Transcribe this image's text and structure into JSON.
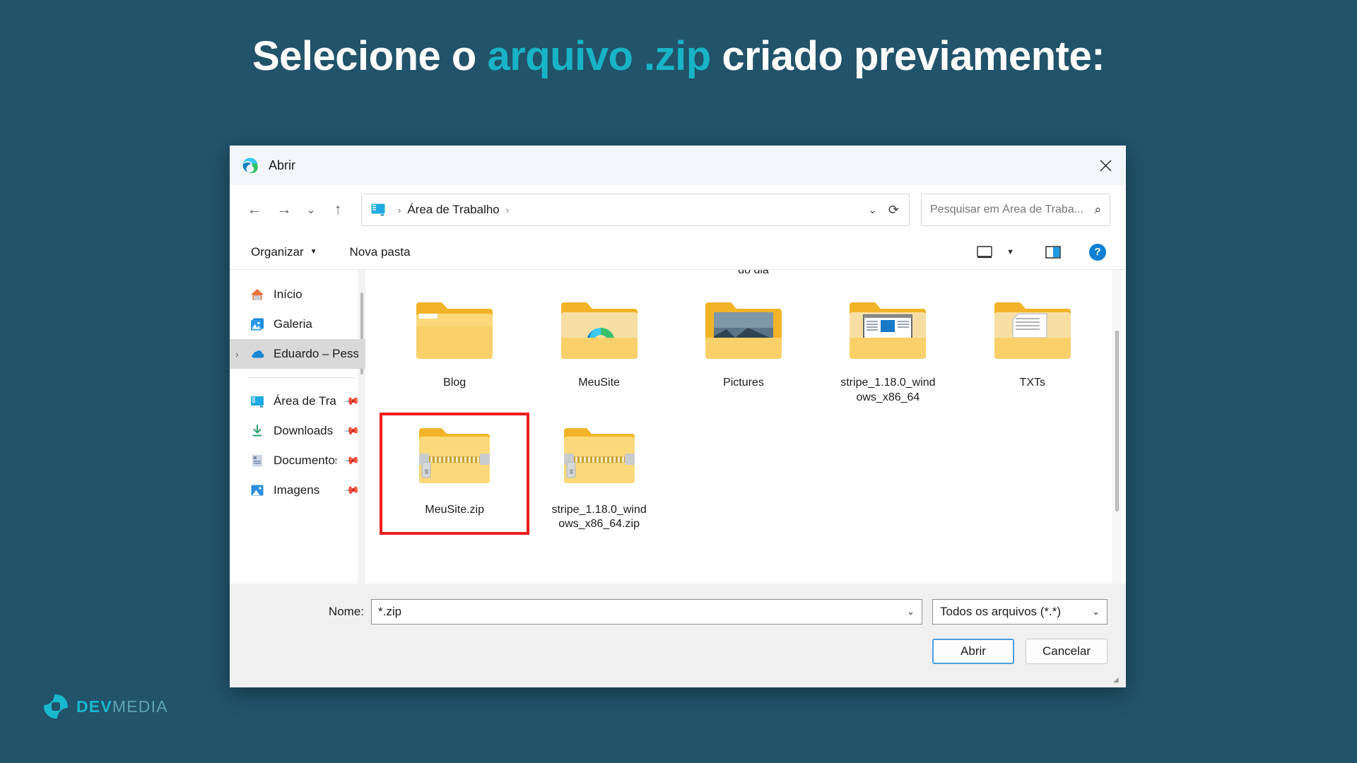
{
  "slide": {
    "background_color": "#21536a",
    "headline": {
      "part1": "Selecione o ",
      "accent": "arquivo .zip",
      "part2": " criado previamente:",
      "accent_color": "#18b4c6",
      "text_color": "#ffffff"
    },
    "logo": {
      "brand_bold": "DEV",
      "brand_light": "MEDIA",
      "icon": "devmedia-logo-icon"
    }
  },
  "dialog": {
    "titlebar": {
      "icon": "edge-logo-icon",
      "title": "Abrir",
      "close_icon": "close-icon"
    },
    "navigation": {
      "back_icon": "arrow-left-icon",
      "forward_icon": "arrow-right-icon",
      "recent_icon": "chevron-down-icon",
      "up_icon": "arrow-up-icon",
      "address_icon": "desktop-icon",
      "breadcrumbs": [
        "Área de Trabalho"
      ],
      "separator": "›",
      "dropdown_icon": "chevron-down-icon",
      "refresh_icon": "refresh-icon"
    },
    "search": {
      "placeholder": "Pesquisar em Área de Traba...",
      "icon": "search-icon"
    },
    "toolbar": {
      "organize_label": "Organizar",
      "organize_caret": "▼",
      "new_folder_label": "Nova pasta",
      "view_icon": "view-layout-icon",
      "view_caret_icon": "chevron-down-icon",
      "preview_pane_icon": "preview-pane-icon",
      "help_icon": "help-icon",
      "help_glyph": "?"
    },
    "sidebar": {
      "scrollbar": "sidebar-scrollbar",
      "items": [
        {
          "label": "Início",
          "icon": "home-icon",
          "pinned": false,
          "selected": false,
          "expandable": false
        },
        {
          "label": "Galeria",
          "icon": "gallery-icon",
          "pinned": false,
          "selected": false,
          "expandable": false
        },
        {
          "label": "Eduardo – Pessoa",
          "icon": "onedrive-icon",
          "pinned": false,
          "selected": true,
          "expandable": true
        },
        {
          "label": "Área de Trabal",
          "icon": "desktop-icon",
          "pinned": true,
          "selected": false,
          "expandable": false
        },
        {
          "label": "Downloads",
          "icon": "downloads-icon",
          "pinned": true,
          "selected": false,
          "expandable": false
        },
        {
          "label": "Documentos",
          "icon": "documents-icon",
          "pinned": true,
          "selected": false,
          "expandable": false
        },
        {
          "label": "Imagens",
          "icon": "pictures-icon",
          "pinned": true,
          "selected": false,
          "expandable": false
        }
      ]
    },
    "files": {
      "clipped_top_text": "do dia",
      "items": [
        {
          "name": "Blog",
          "kind": "folder",
          "thumb": "folder-plain"
        },
        {
          "name": "MeuSite",
          "kind": "folder",
          "thumb": "folder-edge"
        },
        {
          "name": "Pictures",
          "kind": "folder",
          "thumb": "folder-photo"
        },
        {
          "name": "stripe_1.18.0_windows_x86_64",
          "kind": "folder",
          "thumb": "folder-document"
        },
        {
          "name": "TXTs",
          "kind": "folder",
          "thumb": "folder-text"
        },
        {
          "name": "MeuSite.zip",
          "kind": "zip",
          "thumb": "zip-archive",
          "highlighted": true
        },
        {
          "name": "stripe_1.18.0_windows_x86_64.zip",
          "kind": "zip",
          "thumb": "zip-archive",
          "highlighted": false
        }
      ],
      "highlight_color": "#ee1c1c"
    },
    "footer": {
      "name_label": "Nome:",
      "name_value": "*.zip",
      "filter_value": "Todos os arquivos (*.*)",
      "open_button": "Abrir",
      "cancel_button": "Cancelar"
    }
  }
}
